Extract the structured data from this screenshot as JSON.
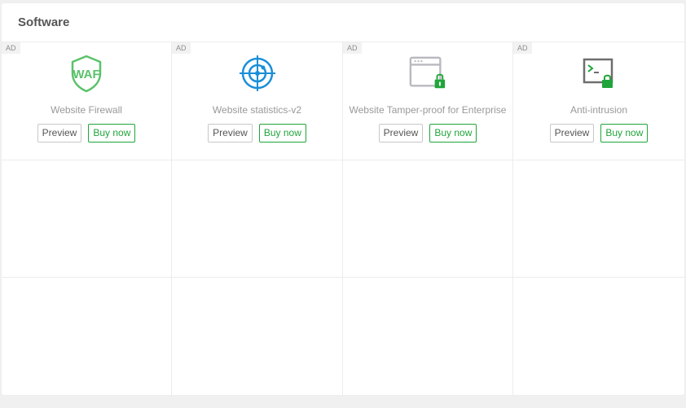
{
  "header": {
    "title": "Software"
  },
  "colors": {
    "accent": "#20a53a",
    "shield": "#5ac26a",
    "target": "#1a8fd8",
    "window": "#b9b9c0",
    "terminal": "#6e6e6e"
  },
  "products": [
    {
      "name": "Website Firewall",
      "ad": "AD",
      "icon": "waf-shield-icon",
      "icon_text": "WAF",
      "preview_label": "Preview",
      "buy_label": "Buy now"
    },
    {
      "name": "Website statistics-v2",
      "ad": "AD",
      "icon": "target-radar-icon",
      "preview_label": "Preview",
      "buy_label": "Buy now"
    },
    {
      "name": "Website Tamper-proof for Enterprise",
      "ad": "AD",
      "icon": "browser-lock-icon",
      "preview_label": "Preview",
      "buy_label": "Buy now"
    },
    {
      "name": "Anti-intrusion",
      "ad": "AD",
      "icon": "terminal-lock-icon",
      "preview_label": "Preview",
      "buy_label": "Buy now"
    }
  ]
}
